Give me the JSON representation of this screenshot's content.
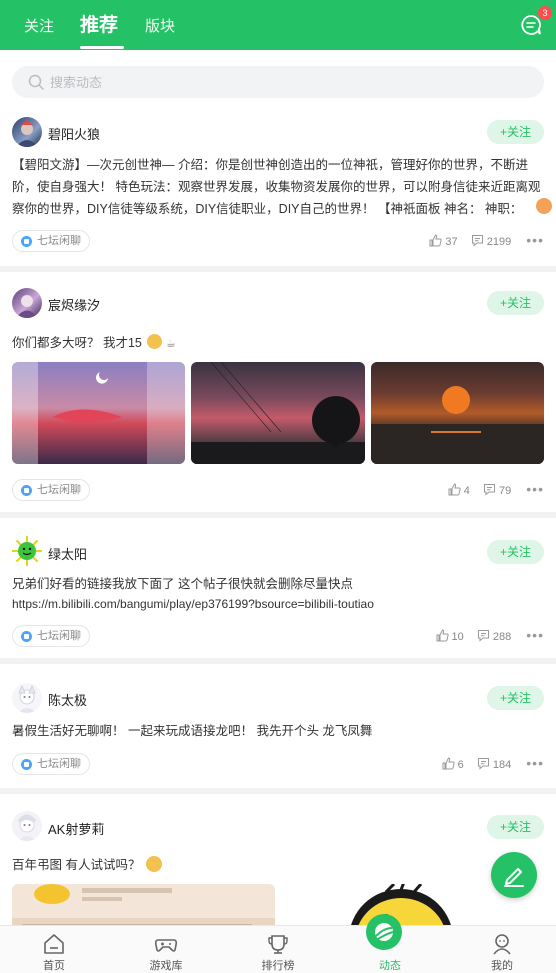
{
  "header": {
    "tabs": [
      {
        "label": "关注"
      },
      {
        "label": "推荐"
      },
      {
        "label": "版块"
      }
    ],
    "active_tab": "推荐",
    "message_badge": "3",
    "message_icon": "chat-bubble-icon"
  },
  "search": {
    "placeholder": "搜索动态"
  },
  "colors": {
    "brand": "#25c166",
    "follow_bg": "#dff5e8",
    "tag_icon": "#4aa3ff"
  },
  "posts": [
    {
      "username": "碧阳火狼",
      "follow_label": "+关注",
      "content": "【碧阳文游】—次元创世神— 介绍：你是创世神创造出的一位神祇，管理好你的世界，不断进阶，使自身强大！ 特色玩法：观察世界发展，收集物资发展你的世界，可以附身信徒来近距离观察你的世界，DIY信徒等级系统，DIY信徒职业，DIY自己的世界！ 【神祇面板 神名： 神职： 神...",
      "tag": "七坛闲聊",
      "likes": "37",
      "comments": "2199"
    },
    {
      "username": "宸烬缘汐",
      "follow_label": "+关注",
      "content": "你们都多大呀？ 我才15",
      "tag": "七坛闲聊",
      "likes": "4",
      "comments": "79"
    },
    {
      "username": "绿太阳",
      "follow_label": "+关注",
      "content": "兄弟们好看的链接我放下面了 这个帖子很快就会删除尽量快点",
      "link": "https://m.bilibili.com/bangumi/play/ep376199?bsource=bilibili-toutiao",
      "tag": "七坛闲聊",
      "likes": "10",
      "comments": "288"
    },
    {
      "username": "陈太极",
      "follow_label": "+关注",
      "content": "暑假生活好无聊啊！ 一起来玩成语接龙吧！ 我先开个头 龙飞凤舞",
      "tag": "七坛闲聊",
      "likes": "6",
      "comments": "184"
    },
    {
      "username": "AK射萝莉",
      "follow_label": "+关注",
      "content": "百年弔图 有人试试吗？"
    }
  ],
  "bottom_nav": [
    {
      "label": "首页",
      "icon": "home-icon"
    },
    {
      "label": "游戏库",
      "icon": "gamepad-icon"
    },
    {
      "label": "排行榜",
      "icon": "trophy-icon"
    },
    {
      "label": "动态",
      "icon": "planet-icon",
      "active": true
    },
    {
      "label": "我的",
      "icon": "user-icon"
    }
  ]
}
